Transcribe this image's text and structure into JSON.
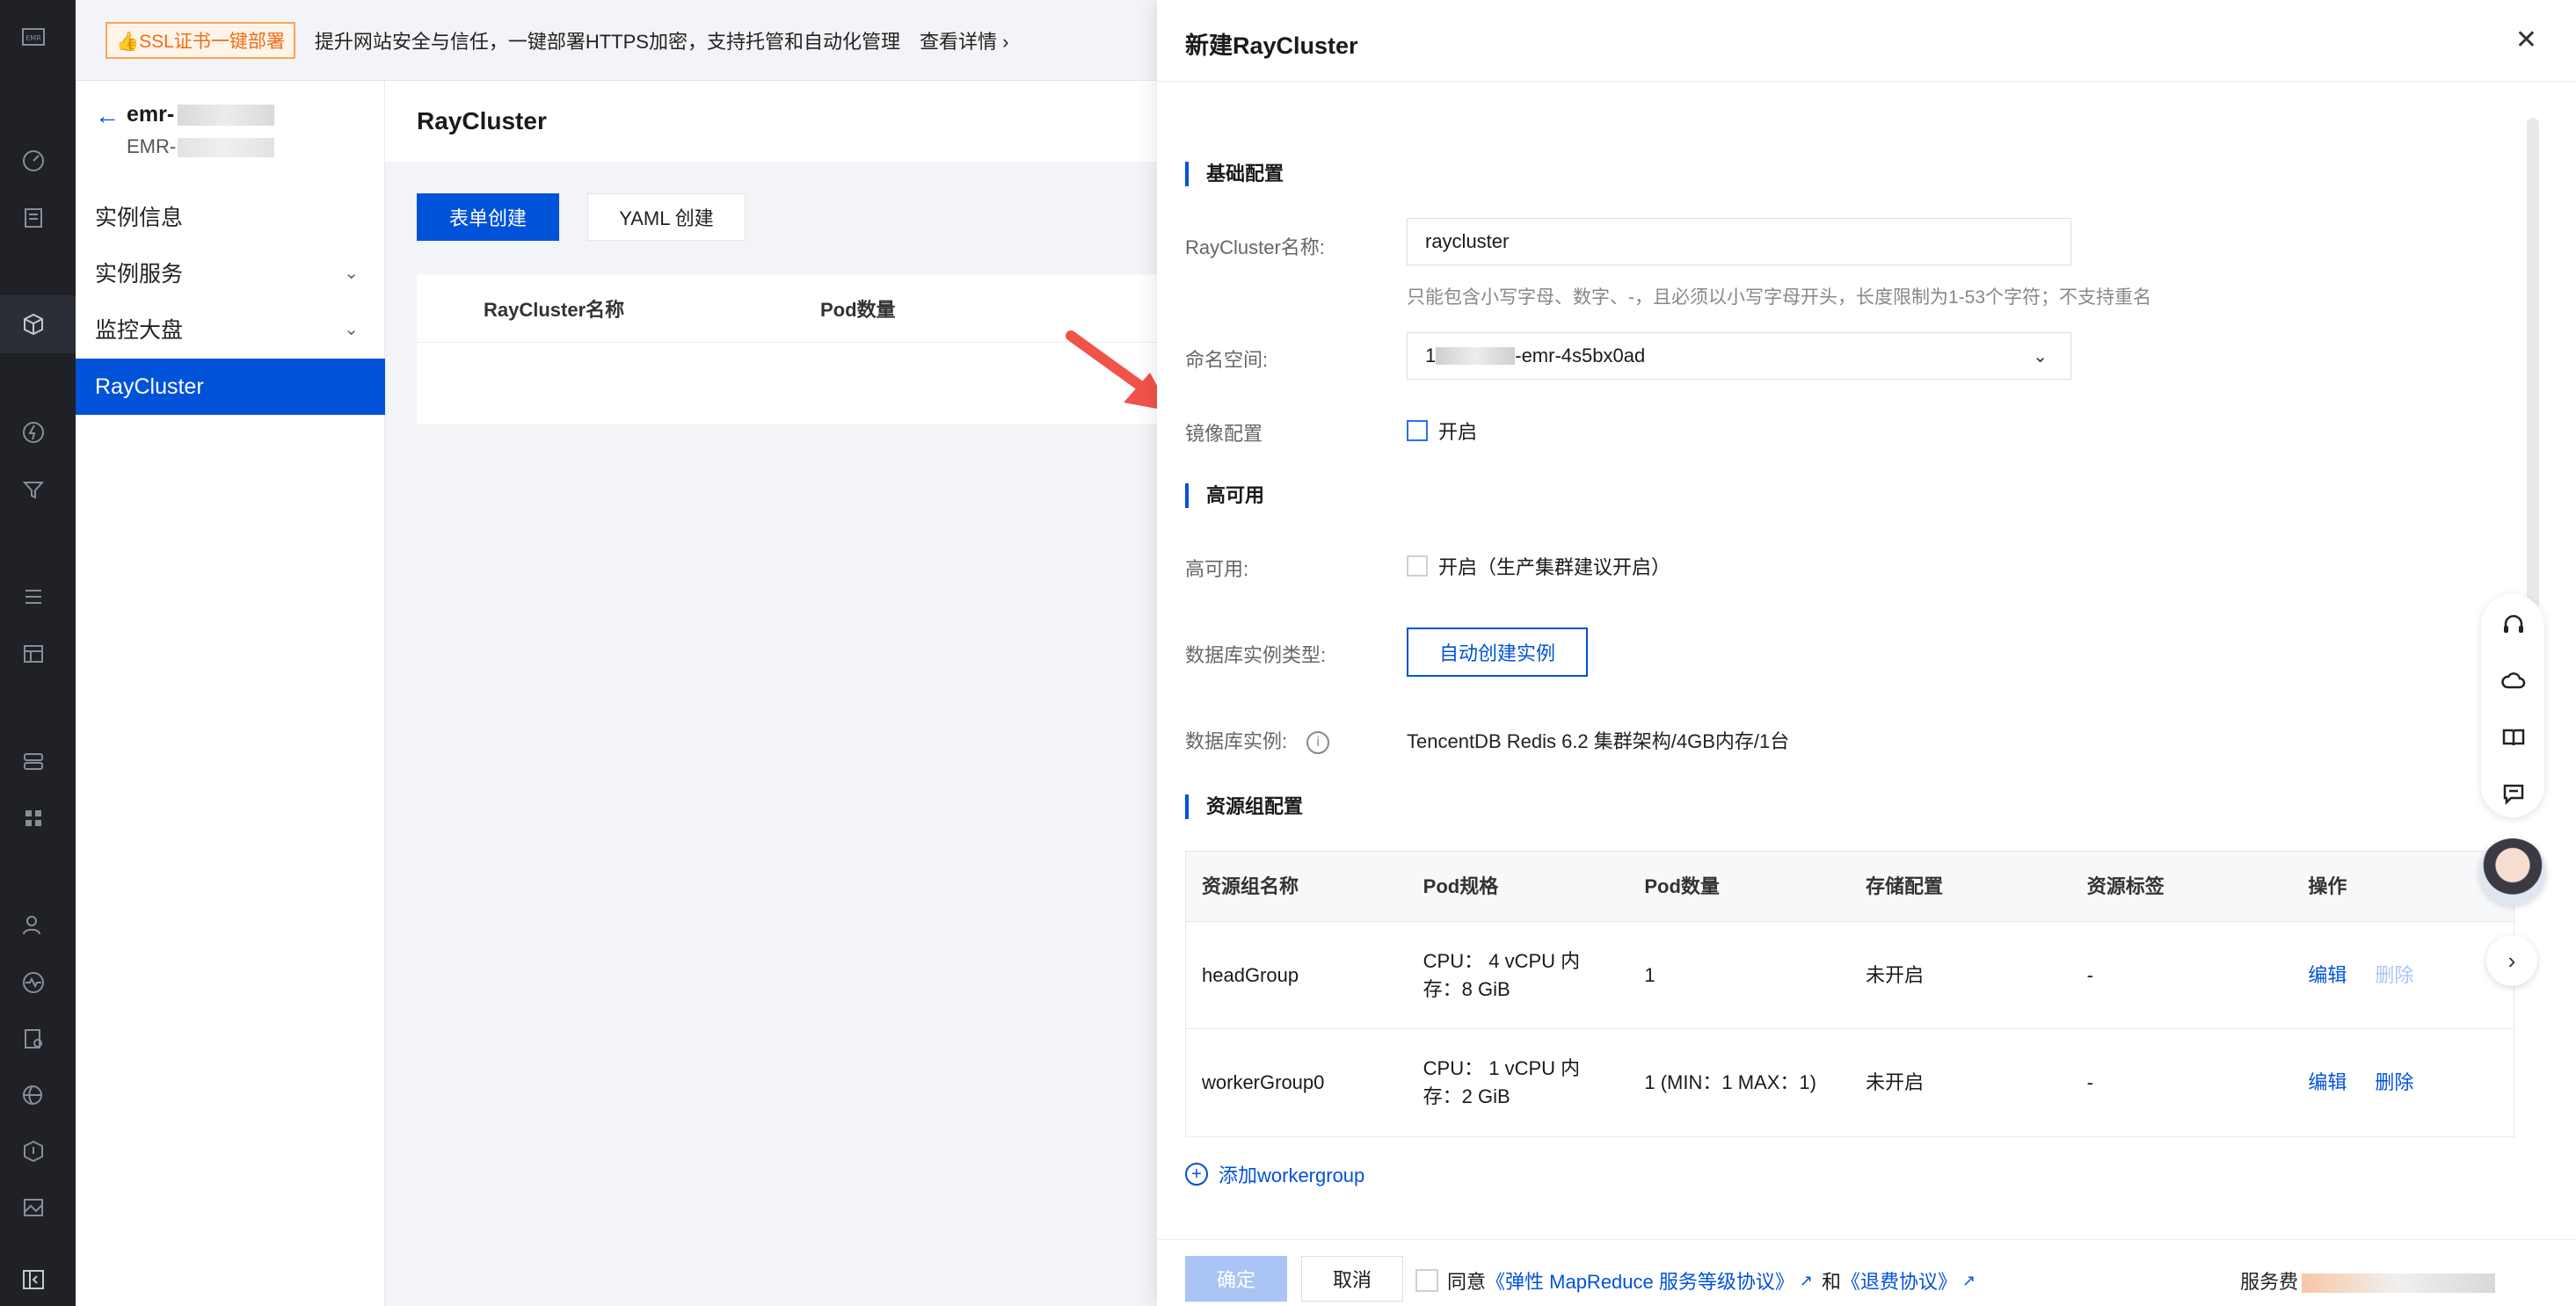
{
  "promo": {
    "tag": "👍SSL证书一键部署",
    "text": "提升网站安全与信任，一键部署HTTPS加密，支持托管和自动化管理",
    "more": "查看详情 ›"
  },
  "rail": {
    "logo": "EMR"
  },
  "sidebar": {
    "cluster_name": "emr-",
    "cluster_id": "EMR-",
    "items": [
      {
        "label": "实例信息"
      },
      {
        "label": "实例服务"
      },
      {
        "label": "监控大盘"
      },
      {
        "label": "RayCluster"
      }
    ]
  },
  "main": {
    "title": "RayCluster",
    "btn_form": "表单创建",
    "btn_yaml": "YAML 创建",
    "columns": [
      "RayCluster名称",
      "Pod数量"
    ]
  },
  "drawer": {
    "title": "新建RayCluster",
    "sections": {
      "basic": "基础配置",
      "ha": "高可用",
      "rg": "资源组配置"
    },
    "name_label": "RayCluster名称:",
    "name_value": "raycluster",
    "name_hint": "只能包含小写字母、数字、-，且必须以小写字母开头，长度限制为1-53个字符；不支持重名",
    "ns_label": "命名空间:",
    "ns_prefix": "1",
    "ns_suffix": "-emr-4s5bx0ad",
    "image_label": "镜像配置",
    "image_check": "开启",
    "ha_label": "高可用:",
    "ha_check": "开启（生产集群建议开启）",
    "db_type_label": "数据库实例类型:",
    "db_type_btn": "自动创建实例",
    "db_inst_label": "数据库实例:",
    "db_inst_value": "TencentDB Redis 6.2 集群架构/4GB内存/1台",
    "table": {
      "headers": [
        "资源组名称",
        "Pod规格",
        "Pod数量",
        "存储配置",
        "资源标签",
        "操作"
      ],
      "rows": [
        {
          "name": "headGroup",
          "spec": "CPU： 4 vCPU 内存：8 GiB",
          "count": "1",
          "storage": "未开启",
          "tags": "-",
          "edit": "编辑",
          "del": "删除"
        },
        {
          "name": "workerGroup0",
          "spec": "CPU： 1 vCPU 内存：2 GiB",
          "count": "1 (MIN：1 MAX：1)",
          "storage": "未开启",
          "tags": "-",
          "edit": "编辑",
          "del": "删除"
        }
      ]
    },
    "add_wg": "添加workergroup",
    "footer": {
      "ok": "确定",
      "cancel": "取消",
      "agree_prefix": "同意",
      "agree_link1": "《弹性 MapReduce 服务等级协议》",
      "agree_mid": "和",
      "agree_link2": "《退费协议》",
      "fee_label": "服务费"
    }
  },
  "colors": {
    "primary": "#0052d9",
    "arrow": "#f0534a",
    "rail": "#1f2126"
  }
}
